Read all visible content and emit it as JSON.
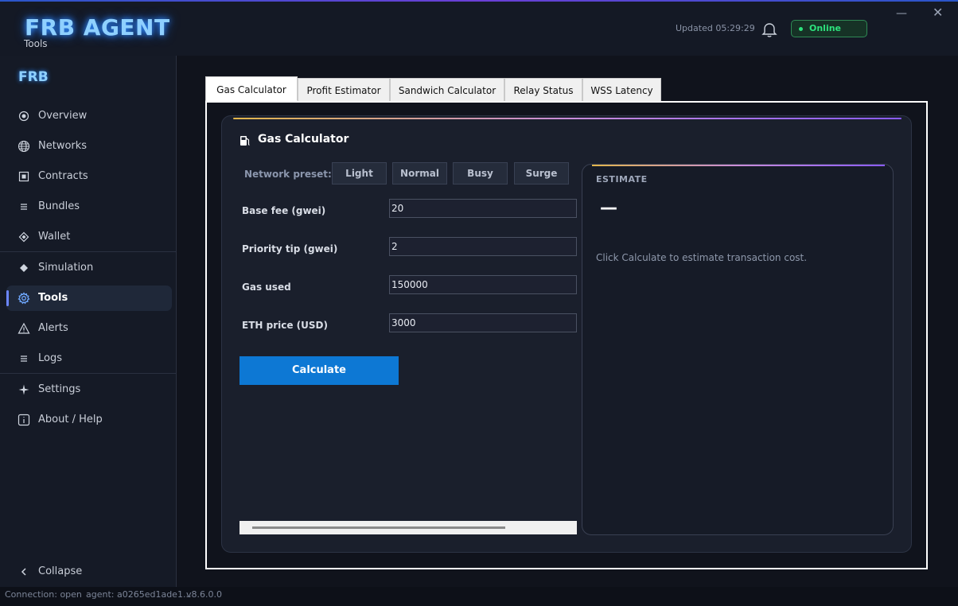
{
  "app": {
    "title": "FRB AGENT",
    "subtitle": "Tools",
    "updated": "Updated 05:29:29",
    "status": "Online",
    "minimize_glyph": "—",
    "close_glyph": "✕"
  },
  "colors": {
    "accent_blue": "#0d78d4",
    "online_green": "#2de27d",
    "brand_glow": "#8fd0ff"
  },
  "sidebar": {
    "logo": "FRB",
    "items": [
      {
        "label": "Overview",
        "icon": "radio-icon"
      },
      {
        "label": "Networks",
        "icon": "globe-icon"
      },
      {
        "label": "Contracts",
        "icon": "square-icon"
      },
      {
        "label": "Bundles",
        "icon": "list-icon"
      },
      {
        "label": "Wallet",
        "icon": "diamond-icon"
      },
      {
        "label": "Simulation",
        "icon": "diamond-filled-icon"
      },
      {
        "label": "Tools",
        "icon": "gear-icon"
      },
      {
        "label": "Alerts",
        "icon": "warning-icon"
      },
      {
        "label": "Logs",
        "icon": "list-icon"
      },
      {
        "label": "Settings",
        "icon": "sparkle-icon"
      },
      {
        "label": "About / Help",
        "icon": "info-icon"
      }
    ],
    "collapse": "Collapse"
  },
  "tabs": [
    "Gas Calculator",
    "Profit Estimator",
    "Sandwich Calculator",
    "Relay Status",
    "WSS Latency"
  ],
  "calculator": {
    "title": "Gas Calculator",
    "preset_label": "Network preset:",
    "presets": [
      "Light",
      "Normal",
      "Busy",
      "Surge"
    ],
    "fields": [
      {
        "label": "Base fee (gwei)",
        "value": "20"
      },
      {
        "label": "Priority tip (gwei)",
        "value": "2"
      },
      {
        "label": "Gas used",
        "value": "150000"
      },
      {
        "label": "ETH price (USD)",
        "value": "3000"
      }
    ],
    "button": "Calculate"
  },
  "estimate": {
    "title": "ESTIMATE",
    "value": "—",
    "hint": "Click Calculate to estimate transaction cost."
  },
  "statusbar": {
    "connection": "Connection: open",
    "agent": "agent: a0265ed1ade1...",
    "version": "v8.6.0.0"
  }
}
